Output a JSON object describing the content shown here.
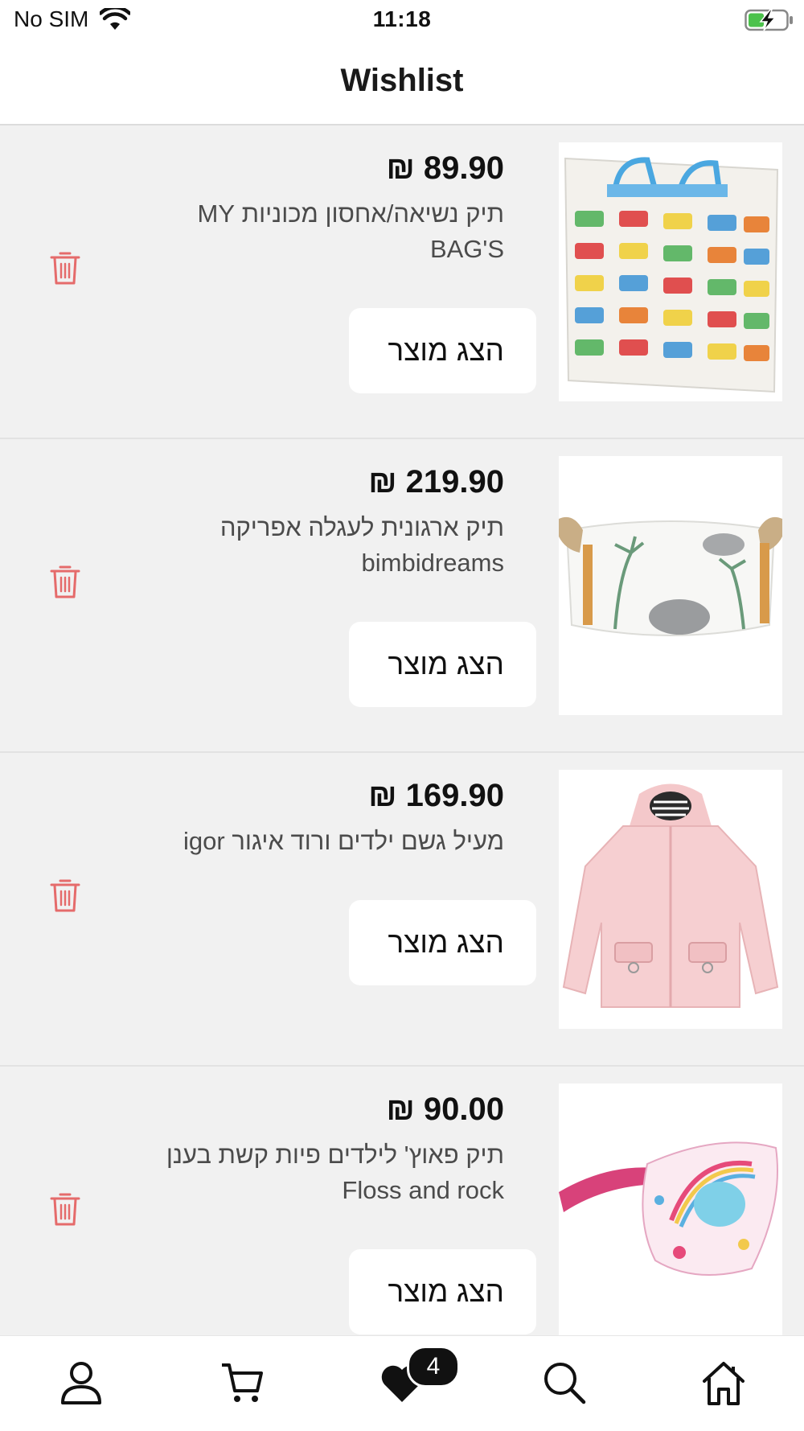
{
  "status_bar": {
    "carrier": "No SIM",
    "time": "11:18",
    "wifi_icon": "wifi-icon",
    "battery_icon": "battery-charging-icon"
  },
  "nav": {
    "title": "Wishlist"
  },
  "colors": {
    "trash": "#e56b6b",
    "list_background": "#f1f1f1",
    "badge": "#111111"
  },
  "items": [
    {
      "price": "₪ 89.90",
      "name": "תיק נשיאה/אחסון מכוניות MY BAG'S",
      "button_label": "הצג מוצר",
      "image_icon": "bus-pattern-bag-image"
    },
    {
      "price": "₪ 219.90",
      "name": "תיק ארגונית לעגלה אפריקה bimbidreams",
      "button_label": "הצג מוצר",
      "image_icon": "safari-organizer-bag-image"
    },
    {
      "price": "₪ 169.90",
      "name": "מעיל גשם ילדים ורוד איגור igor",
      "button_label": "הצג מוצר",
      "image_icon": "pink-raincoat-image"
    },
    {
      "price": "₪ 90.00",
      "name": "תיק פאוץ' לילדים פיות קשת בענן Floss and rock",
      "button_label": "הצג מוצר",
      "image_icon": "unicorn-pouch-image"
    }
  ],
  "tab_bar": {
    "tabs": [
      "profile-icon",
      "cart-icon",
      "wishlist-heart-icon",
      "search-icon",
      "home-icon"
    ],
    "wishlist_badge": "4"
  }
}
